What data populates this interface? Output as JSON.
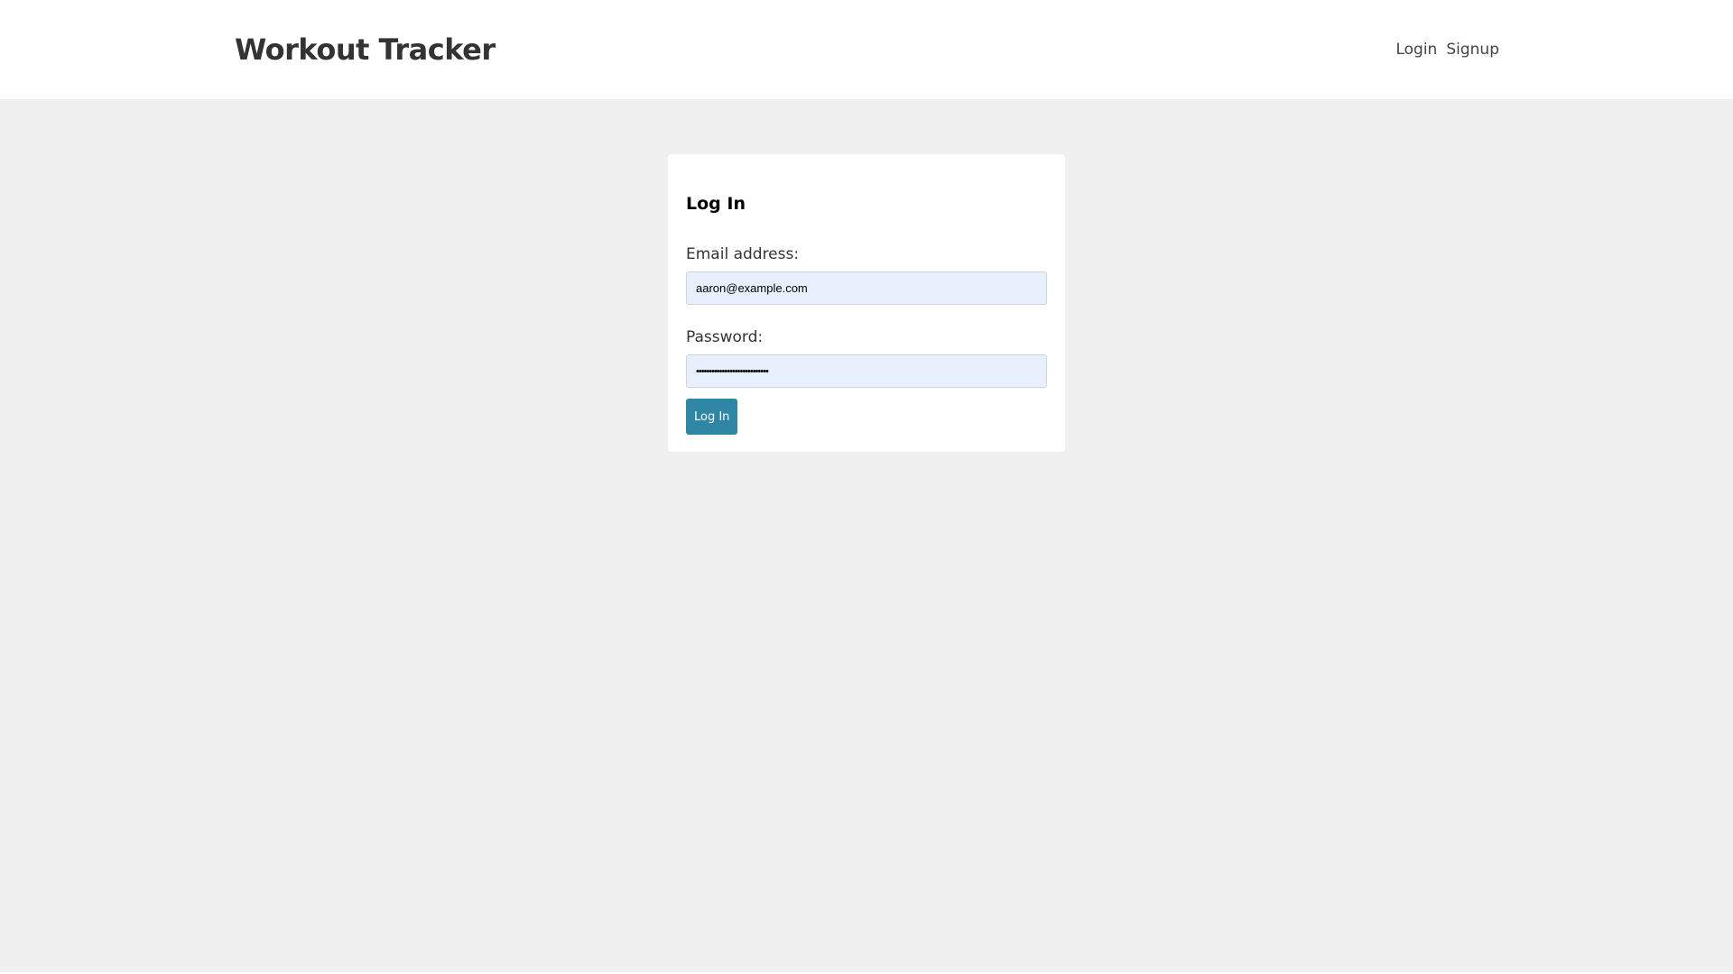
{
  "header": {
    "brand": "Workout Tracker",
    "nav": [
      {
        "label": "Login"
      },
      {
        "label": "Signup"
      }
    ]
  },
  "login_form": {
    "title": "Log In",
    "email": {
      "label": "Email address:",
      "value": "aaron@example.com"
    },
    "password": {
      "label": "Password:",
      "value": "••••••••••••••••••••••••••••"
    },
    "submit_label": "Log In"
  },
  "colors": {
    "accent": "#2e86a4",
    "background": "#f0f0f0",
    "autofill": "#e8f0fe"
  }
}
